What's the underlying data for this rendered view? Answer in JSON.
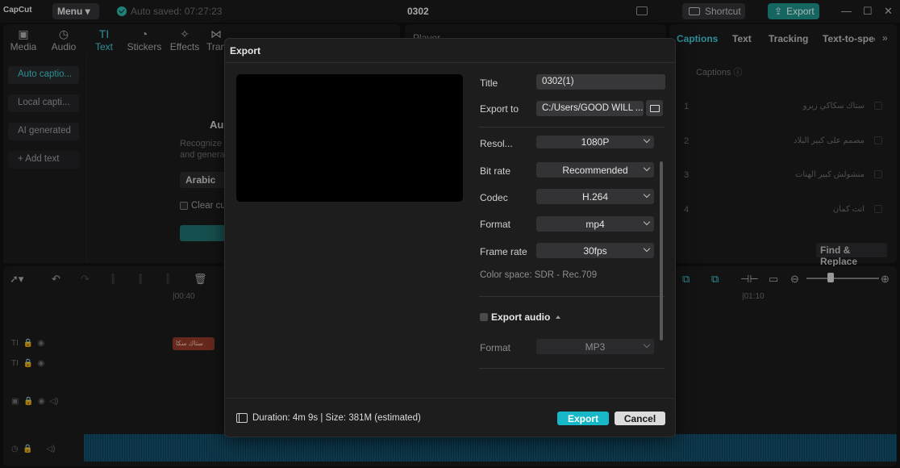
{
  "app": {
    "logo": "CapCut",
    "menu_label": "Menu",
    "autosave": "Auto saved: 07:27:23",
    "project_name": "0302",
    "shortcut_label": "Shortcut",
    "export_label": "Export"
  },
  "left_panel": {
    "tools": [
      {
        "icon": "media-icon",
        "label": "Media"
      },
      {
        "icon": "audio-icon",
        "label": "Audio"
      },
      {
        "icon": "text-icon",
        "label": "Text"
      },
      {
        "icon": "stickers-icon",
        "label": "Stickers"
      },
      {
        "icon": "effects-icon",
        "label": "Effects"
      },
      {
        "icon": "transitions-icon",
        "label": "Tran"
      }
    ],
    "active_tool": "Text",
    "sub_items": [
      "Auto captio...",
      "Local capti...",
      "AI generated",
      "+ Add text"
    ],
    "auto_title": "Au",
    "desc_line1": "Recognize",
    "desc_line2": "and genera",
    "language": "Arabic",
    "clear_label": "Clear cu"
  },
  "player": {
    "label": "Player"
  },
  "right_panel": {
    "tabs": [
      "Captions",
      "Text",
      "Tracking",
      "Text-to-spee"
    ],
    "active_tab": "Captions",
    "captions_header": "Captions ⓘ",
    "rows": [
      {
        "num": "1",
        "text": "ستاك سكاكي زيرو"
      },
      {
        "num": "2",
        "text": "مصمم على كبير البلاد"
      },
      {
        "num": "3",
        "text": "منشولش كبير الهنات"
      },
      {
        "num": "4",
        "text": "انت كمان"
      }
    ],
    "find_replace": "Find & Replace"
  },
  "timeline": {
    "ruler_left": "|00:40",
    "ruler_right": "|01:10",
    "text_clip": "ستاك سكا"
  },
  "dialog": {
    "title": "Export",
    "fields": {
      "title_label": "Title",
      "title_value": "0302(1)",
      "export_to_label": "Export to",
      "export_to_value": "C:/Users/GOOD WILL ...",
      "resolution_label": "Resol...",
      "resolution_value": "1080P",
      "bitrate_label": "Bit rate",
      "bitrate_value": "Recommended",
      "codec_label": "Codec",
      "codec_value": "H.264",
      "format_label": "Format",
      "format_value": "mp4",
      "framerate_label": "Frame rate",
      "framerate_value": "30fps",
      "color_space": "Color space: SDR - Rec.709",
      "export_audio_label": "Export audio",
      "audio_format_label": "Format",
      "audio_format_value": "MP3"
    },
    "footer": {
      "info": "Duration: 4m 9s | Size: 381M (estimated)",
      "export_button": "Export",
      "cancel_button": "Cancel"
    }
  },
  "colors": {
    "accent": "#17b7c7",
    "export_top": "#1e8c86",
    "background": "#111112"
  }
}
